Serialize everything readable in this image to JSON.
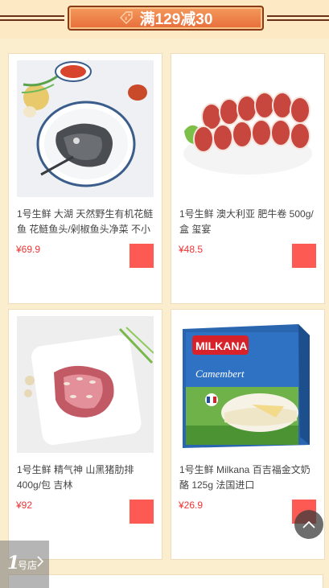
{
  "banner": {
    "label": "满129减30",
    "icon": "price-tag-icon"
  },
  "products": [
    {
      "title": "1号生鲜 大湖 天然野生有机花鲢鱼 花鲢鱼头/剁椒鱼头净菜 不小",
      "price": "¥69.9",
      "image": "fish-head-image"
    },
    {
      "title": "1号生鲜 澳大利亚 肥牛卷 500g/盒 玺宴",
      "price": "¥48.5",
      "image": "beef-rolls-image"
    },
    {
      "title": "1号生鲜 精气神 山黑猪肋排 400g/包 吉林",
      "price": "¥92",
      "image": "pork-ribs-image"
    },
    {
      "title": "1号生鲜 Milkana 百吉福金文奶酪 125g 法国进口",
      "price": "¥26.9",
      "image": "milkana-cheese-image"
    }
  ],
  "milkana_box": {
    "brand": "MILKANA",
    "name": "Camembert"
  },
  "logo": {
    "number": "1",
    "text": "号店"
  },
  "colors": {
    "accent": "#fe5a54",
    "price": "#e33333",
    "background": "#fbeecf"
  }
}
